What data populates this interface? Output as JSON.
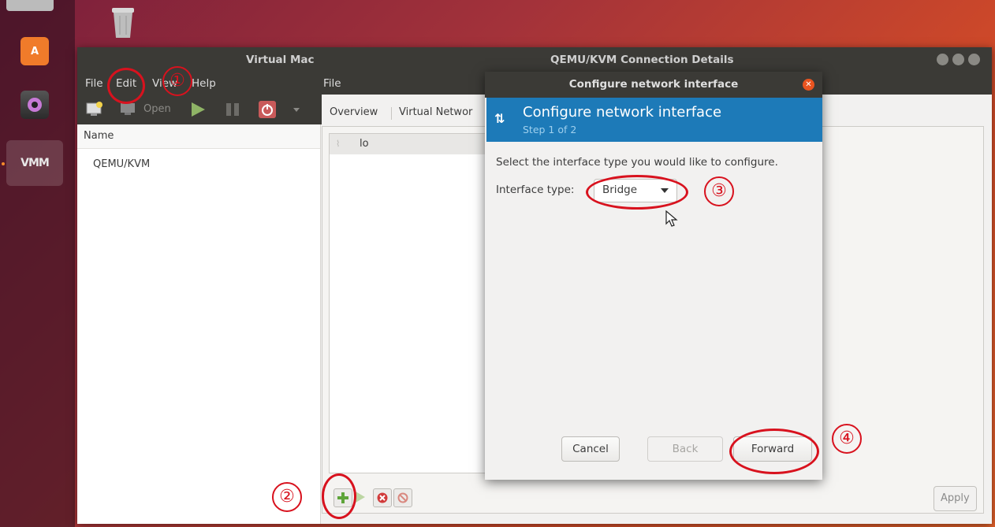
{
  "window": {
    "manager_title": "Virtual Mac",
    "details_title": "QEMU/KVM Connection Details",
    "menu": [
      "File",
      "Edit",
      "View",
      "Help"
    ],
    "details_menu_file": "File",
    "toolbar_open": "Open"
  },
  "manager": {
    "column_header": "Name",
    "connection": "QEMU/KVM"
  },
  "details": {
    "tabs": [
      "Overview",
      "Virtual Networ"
    ],
    "interfaces": [
      "lo"
    ],
    "apply_label": "Apply"
  },
  "dialog": {
    "title": "Configure network interface",
    "banner_title": "Configure network interface",
    "banner_step": "Step 1 of 2",
    "instruction": "Select the interface type you would like to configure.",
    "interface_type_label": "Interface type:",
    "interface_type_value": "Bridge",
    "cancel": "Cancel",
    "back": "Back",
    "forward": "Forward"
  },
  "annotations": [
    "①",
    "②",
    "③",
    "④"
  ],
  "dock": {
    "store_letter": "A",
    "vm_label": "VMM"
  },
  "colors": {
    "accent": "#e95420",
    "banner": "#1d7ab8",
    "annotation": "#d8121e"
  }
}
